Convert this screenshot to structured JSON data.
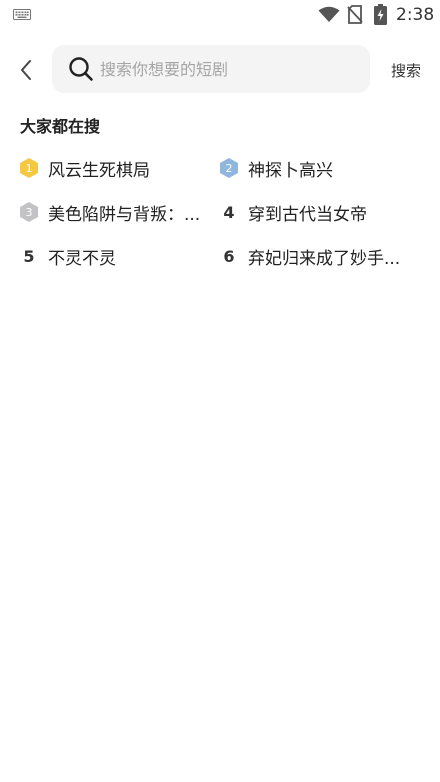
{
  "status_bar": {
    "time": "2:38",
    "icons": [
      "keyboard-icon",
      "wifi-icon",
      "no-sim-icon",
      "battery-charging-icon"
    ]
  },
  "header": {
    "back_icon": "chevron-left-icon",
    "search_icon": "search-icon",
    "search_placeholder": "搜索你想要的短剧",
    "search_value": "",
    "search_button_label": "搜索"
  },
  "section": {
    "title": "大家都在搜",
    "items": [
      {
        "rank": "1",
        "label": "风云生死棋局",
        "badge": "gold-hexagon-badge"
      },
      {
        "rank": "2",
        "label": "神探卜高兴",
        "badge": "blue-hexagon-badge"
      },
      {
        "rank": "3",
        "label": "美色陷阱与背叛：...",
        "badge": "silver-hexagon-badge"
      },
      {
        "rank": "4",
        "label": "穿到古代当女帝",
        "badge": ""
      },
      {
        "rank": "5",
        "label": "不灵不灵",
        "badge": ""
      },
      {
        "rank": "6",
        "label": "弃妃归来成了妙手...",
        "badge": ""
      }
    ]
  },
  "colors": {
    "badge_gold": "#f5c842",
    "badge_blue": "#8fb6de",
    "badge_silver": "#c3c3c6",
    "search_bg": "#f4f4f4"
  }
}
